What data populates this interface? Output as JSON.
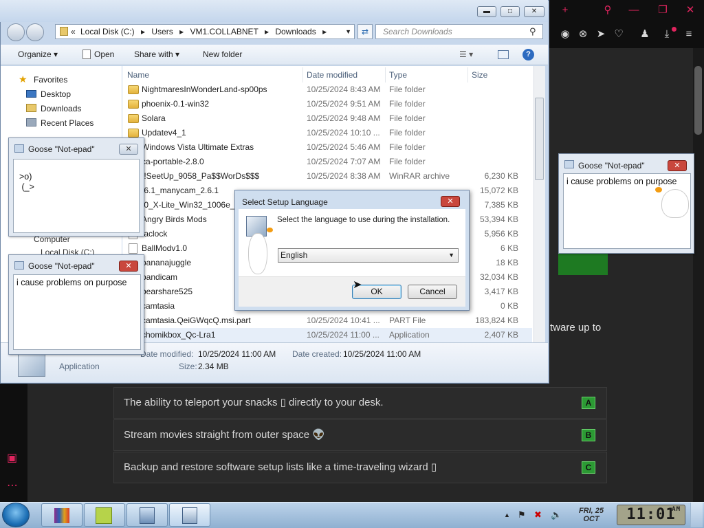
{
  "explorer": {
    "breadcrumb": [
      "Local Disk (C:)",
      "Users",
      "VM1.COLLABNET",
      "Downloads"
    ],
    "search_placeholder": "Search Downloads",
    "toolbar": {
      "organize": "Organize",
      "open": "Open",
      "share_with": "Share with",
      "new_folder": "New folder"
    },
    "nav": {
      "favorites": "Favorites",
      "desktop": "Desktop",
      "downloads": "Downloads",
      "recent": "Recent Places",
      "computer": "Computer",
      "local_disk": "Local Disk (C:)"
    },
    "columns": {
      "name": "Name",
      "date": "Date modified",
      "type": "Type",
      "size": "Size"
    },
    "files": [
      {
        "name": "NightmaresInWonderLand-sp00ps",
        "date": "10/25/2024 8:43 AM",
        "type": "File folder",
        "size": "",
        "kind": "folder"
      },
      {
        "name": "phoenix-0.1-win32",
        "date": "10/25/2024 9:51 AM",
        "type": "File folder",
        "size": "",
        "kind": "folder"
      },
      {
        "name": "Solara",
        "date": "10/25/2024 9:48 AM",
        "type": "File folder",
        "size": "",
        "kind": "folder"
      },
      {
        "name": "Updatev4_1",
        "date": "10/25/2024 10:10 ...",
        "type": "File folder",
        "size": "",
        "kind": "folder"
      },
      {
        "name": "Windows Vista Ultimate Extras",
        "date": "10/25/2024 5:46 AM",
        "type": "File folder",
        "size": "",
        "kind": "folder"
      },
      {
        "name": "ca-portable-2.8.0",
        "date": "10/25/2024 7:07 AM",
        "type": "File folder",
        "size": "",
        "kind": "folder"
      },
      {
        "name": "!!SeetUp_9058_Pa$$WorDs$$$",
        "date": "10/25/2024 8:38 AM",
        "type": "WinRAR archive",
        "size": "6,230 KB",
        "kind": "file"
      },
      {
        "name": ".6.1_manycam_2.6.1",
        "date": "",
        "type": "",
        "size": "15,072 KB",
        "kind": "file"
      },
      {
        "name": ".0_X-Lite_Win32_1006e_3",
        "date": "",
        "type": "",
        "size": "7,385 KB",
        "kind": "file"
      },
      {
        "name": "Angry Birds Mods",
        "date": "",
        "type": "",
        "size": "53,394 KB",
        "kind": "file"
      },
      {
        "name": "taclock",
        "date": "",
        "type": "",
        "size": "5,956 KB",
        "kind": "file"
      },
      {
        "name": "BallModv1.0",
        "date": "",
        "type": "",
        "size": "6 KB",
        "kind": "file"
      },
      {
        "name": "bananajuggle",
        "date": "",
        "type": "",
        "size": "18 KB",
        "kind": "file"
      },
      {
        "name": "bandicam",
        "date": "",
        "type": "",
        "size": "32,034 KB",
        "kind": "file"
      },
      {
        "name": "bearshare525",
        "date": "",
        "type": "",
        "size": "3,417 KB",
        "kind": "file"
      },
      {
        "name": "camtasia",
        "date": "",
        "type": "",
        "size": "0 KB",
        "kind": "file"
      },
      {
        "name": "camtasia.QeiGWqcQ.msi.part",
        "date": "10/25/2024 10:41 ...",
        "type": "PART File",
        "size": "183,824 KB",
        "kind": "file"
      },
      {
        "name": "chomikbox_Qc-Lra1",
        "date": "10/25/2024 11:00 ...",
        "type": "Application",
        "size": "2,407 KB",
        "kind": "file"
      }
    ],
    "details": {
      "type": "Application",
      "modified_label": "Date modified:",
      "modified": "10/25/2024 11:00 AM",
      "created_label": "Date created:",
      "created": "10/25/2024 11:00 AM",
      "size_label": "Size:",
      "size": "2.34 MB"
    }
  },
  "goose1": {
    "title": "Goose \"Not-epad\"",
    "text": ">o)\n (_>"
  },
  "goose2": {
    "title": "Goose \"Not-epad\"",
    "text": "i cause problems on purpose"
  },
  "goose3": {
    "title": "Goose \"Not-epad\"",
    "text": "i cause problems on purpose"
  },
  "setup": {
    "title": "Select Setup Language",
    "prompt": "Select the language to use during the installation.",
    "language": "English",
    "ok": "OK",
    "cancel": "Cancel"
  },
  "background": {
    "partial_text": "tware up to",
    "options": [
      {
        "text": "The ability to teleport your snacks ▯ directly to your desk.",
        "key": "A"
      },
      {
        "text": "Stream movies straight from outer space 👽",
        "key": "B"
      },
      {
        "text": "Backup and restore software setup lists like a time-traveling wizard ▯",
        "key": "C"
      }
    ]
  },
  "taskbar": {
    "day": "FRI, 25",
    "month": "OCT",
    "time": "11:01",
    "ampm": "AM"
  },
  "colors": {
    "accent_green": "#2c9a34",
    "browser_bg": "#262626",
    "aero_blue": "#c8d8ec"
  }
}
